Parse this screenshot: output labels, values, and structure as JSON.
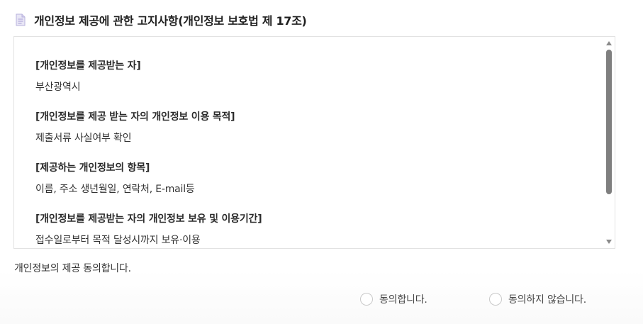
{
  "header": {
    "icon": "document-icon",
    "title": "개인정보 제공에 관한 고지사항(개인정보 보호법 제 17조)"
  },
  "notice": {
    "sections": [
      {
        "heading": "[개인정보를 제공받는 자]",
        "body": "부산광역시"
      },
      {
        "heading": "[개인정보를 제공 받는 자의 개인정보 이용 목적]",
        "body": "제출서류 사실여부 확인"
      },
      {
        "heading": "[제공하는 개인정보의 항목]",
        "body": "이름, 주소 생년월일, 연락처, E-mail등"
      },
      {
        "heading": "[개인정보를 제공받는 자의 개인정보 보유 및 이용기간]",
        "body": "접수일로부터 목적 달성시까지 보유·이용"
      }
    ]
  },
  "consent": {
    "question": "개인정보의 제공 동의합니다.",
    "options": [
      {
        "label": "동의합니다.",
        "selected": false
      },
      {
        "label": "동의하지 않습니다.",
        "selected": false
      }
    ]
  }
}
